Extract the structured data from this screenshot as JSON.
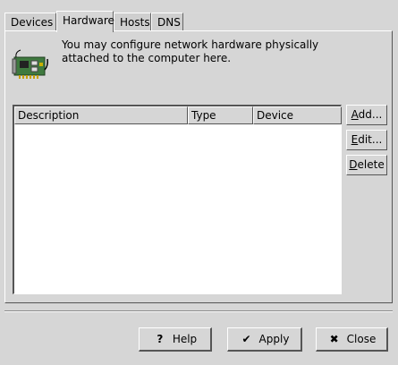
{
  "tabs": [
    {
      "label": "Devices"
    },
    {
      "label": "Hardware",
      "active": true
    },
    {
      "label": "Hosts"
    },
    {
      "label": "DNS"
    }
  ],
  "intro_text": "You may configure network hardware physically attached to the computer here.",
  "hardware_icon": "network-card-icon",
  "list": {
    "columns": [
      "Description",
      "Type",
      "Device"
    ],
    "rows": []
  },
  "side_buttons": {
    "add_mnemonic": "A",
    "add_rest": "dd...",
    "edit_mnemonic": "E",
    "edit_rest": "dit...",
    "delete_mnemonic": "D",
    "delete_rest": "elete"
  },
  "buttons": {
    "help_label": "Help",
    "help_icon": "question-icon",
    "apply_label": "Apply",
    "apply_icon": "checkmark-icon",
    "close_label": "Close",
    "close_icon": "x-icon"
  }
}
